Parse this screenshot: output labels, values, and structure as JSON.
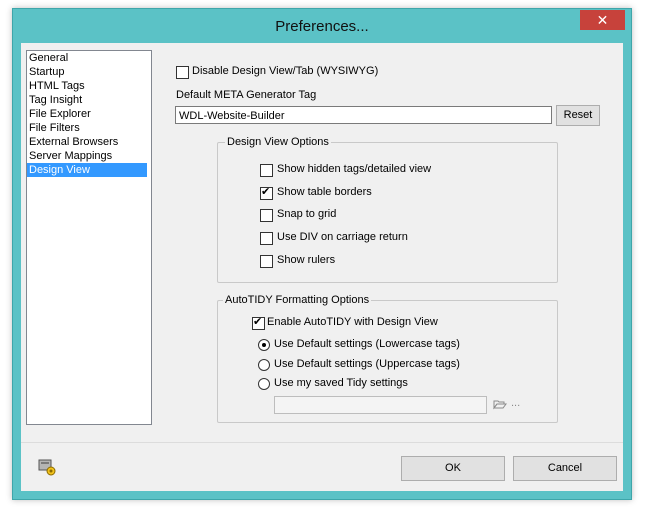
{
  "window": {
    "title": "Preferences...",
    "close_glyph": "✕"
  },
  "nav": {
    "items": [
      "General",
      "Startup",
      "HTML Tags",
      "Tag Insight",
      "File Explorer",
      "File Filters",
      "External Browsers",
      "Server Mappings",
      "Design View"
    ],
    "selected": "Design View"
  },
  "panel": {
    "disable_design_view": {
      "label": "Disable Design View/Tab (WYSIWYG)",
      "checked": false
    },
    "meta_tag_label": "Default META Generator Tag",
    "meta_tag_value": "WDL-Website-Builder",
    "reset_label": "Reset",
    "design_group": {
      "title": "Design View Options",
      "options": [
        {
          "label": "Show hidden tags/detailed view",
          "checked": false
        },
        {
          "label": "Show table borders",
          "checked": true
        },
        {
          "label": "Snap to grid",
          "checked": false
        },
        {
          "label": "Use DIV on carriage return",
          "checked": false
        },
        {
          "label": "Show rulers",
          "checked": false
        }
      ]
    },
    "tidy_group": {
      "title": "AutoTIDY Formatting Options",
      "enable": {
        "label": "Enable AutoTIDY with Design View",
        "checked": true
      },
      "radios": [
        {
          "label": "Use Default settings (Lowercase tags)",
          "selected": true
        },
        {
          "label": "Use Default settings (Uppercase tags)",
          "selected": false
        },
        {
          "label": "Use my saved Tidy settings",
          "selected": false
        }
      ],
      "tidy_path_value": "",
      "ellipsis": "..."
    }
  },
  "footer": {
    "ok_label": "OK",
    "cancel_label": "Cancel"
  },
  "colors": {
    "titlebar": "#5bc2c6",
    "close": "#c7423b",
    "selection": "#3399ff"
  }
}
